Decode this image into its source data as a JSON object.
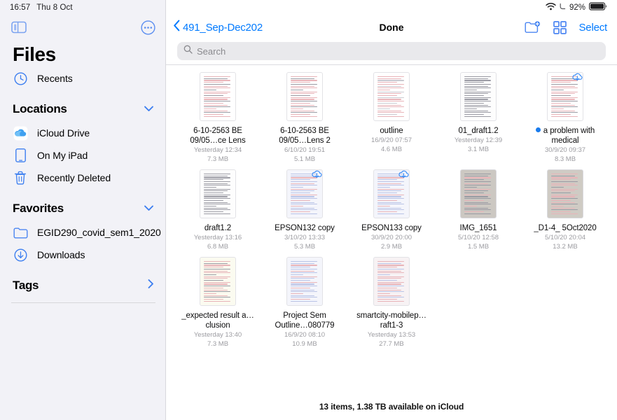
{
  "status": {
    "time": "16:57",
    "date": "Thu 8 Oct",
    "battery_pct": "92%",
    "wifi_icon": "wifi-icon",
    "battery_icon": "battery-icon",
    "location_icon": "location-arrow-icon"
  },
  "sidebar": {
    "toggle_icon": "sidebar-toggle-icon",
    "more_icon": "ellipsis-circle-icon",
    "app_title": "Files",
    "recents": {
      "label": "Recents",
      "icon": "clock-icon"
    },
    "sections": [
      {
        "title": "Locations",
        "chevron": "chevron-down-icon",
        "items": [
          {
            "label": "iCloud Drive",
            "icon": "icloud-icon"
          },
          {
            "label": "On My iPad",
            "icon": "ipad-icon"
          },
          {
            "label": "Recently Deleted",
            "icon": "trash-icon"
          }
        ]
      },
      {
        "title": "Favorites",
        "chevron": "chevron-down-icon",
        "items": [
          {
            "label": "EGID290_covid_sem1_2020",
            "icon": "folder-icon"
          },
          {
            "label": "Downloads",
            "icon": "download-circle-icon"
          }
        ]
      }
    ],
    "tags": {
      "title": "Tags",
      "chevron": "chevron-right-icon"
    }
  },
  "navbar": {
    "back_icon": "chevron-left-icon",
    "back_label": "491_Sep-Dec202",
    "title": "Done",
    "new_folder_icon": "new-folder-icon",
    "grid_view_icon": "grid-view-icon",
    "select_label": "Select"
  },
  "search": {
    "icon": "search-icon",
    "placeholder": "Search",
    "value": ""
  },
  "files": [
    {
      "name": "6-10-2563 BE 09/05…ce Lens",
      "date": "Yesterday 12:34",
      "size": "7.3 MB",
      "cloud": false,
      "tag": null,
      "style": "doc-red"
    },
    {
      "name": "6-10-2563 BE 09/05…Lens 2",
      "date": "6/10/20 19:51",
      "size": "5.1 MB",
      "cloud": false,
      "tag": null,
      "style": "doc-red"
    },
    {
      "name": "outline",
      "date": "16/9/20 07:57",
      "size": "4.6 MB",
      "cloud": false,
      "tag": null,
      "style": "doc-sparse"
    },
    {
      "name": "01_draft1.2",
      "date": "Yesterday 12:39",
      "size": "3.1 MB",
      "cloud": false,
      "tag": null,
      "style": "doc-dense"
    },
    {
      "name": "a problem with medical",
      "date": "30/9/20 09:37",
      "size": "8.3 MB",
      "cloud": true,
      "tag": "#1a7ced",
      "style": "doc-red"
    },
    {
      "name": "draft1.2",
      "date": "Yesterday 13:16",
      "size": "6.8 MB",
      "cloud": false,
      "tag": null,
      "style": "doc-dense"
    },
    {
      "name": "EPSON132 copy",
      "date": "3/10/20 13:33",
      "size": "5.3 MB",
      "cloud": true,
      "tag": null,
      "style": "doc-blue"
    },
    {
      "name": "EPSON133 copy",
      "date": "30/9/20 20:00",
      "size": "2.9 MB",
      "cloud": true,
      "tag": null,
      "style": "doc-blue"
    },
    {
      "name": "IMG_1651",
      "date": "5/10/20 12:58",
      "size": "1.5 MB",
      "cloud": false,
      "tag": null,
      "style": "photo-desk"
    },
    {
      "name": "_D1-4_ 5Oct2020",
      "date": "5/10/20 20:04",
      "size": "13.2 MB",
      "cloud": false,
      "tag": null,
      "style": "photo-gray"
    },
    {
      "name": "_expected result a…clusion",
      "date": "Yesterday 13:40",
      "size": "7.3 MB",
      "cloud": false,
      "tag": null,
      "style": "doc-cream"
    },
    {
      "name": "Project Sem Outline…080779",
      "date": "16/9/20 08:10",
      "size": "10.9 MB",
      "cloud": false,
      "tag": null,
      "style": "doc-blue"
    },
    {
      "name": "smartcity-mobilep…raft1-3",
      "date": "Yesterday 13:53",
      "size": "27.7 MB",
      "cloud": false,
      "tag": null,
      "style": "doc-pink"
    }
  ],
  "footer": {
    "status": "13 items, 1.38 TB available on iCloud"
  },
  "colors": {
    "accent": "#007aff",
    "tag_blue": "#1a7ced",
    "sidebar_bg": "#f2f2f7",
    "search_bg": "#e9e9ec"
  }
}
